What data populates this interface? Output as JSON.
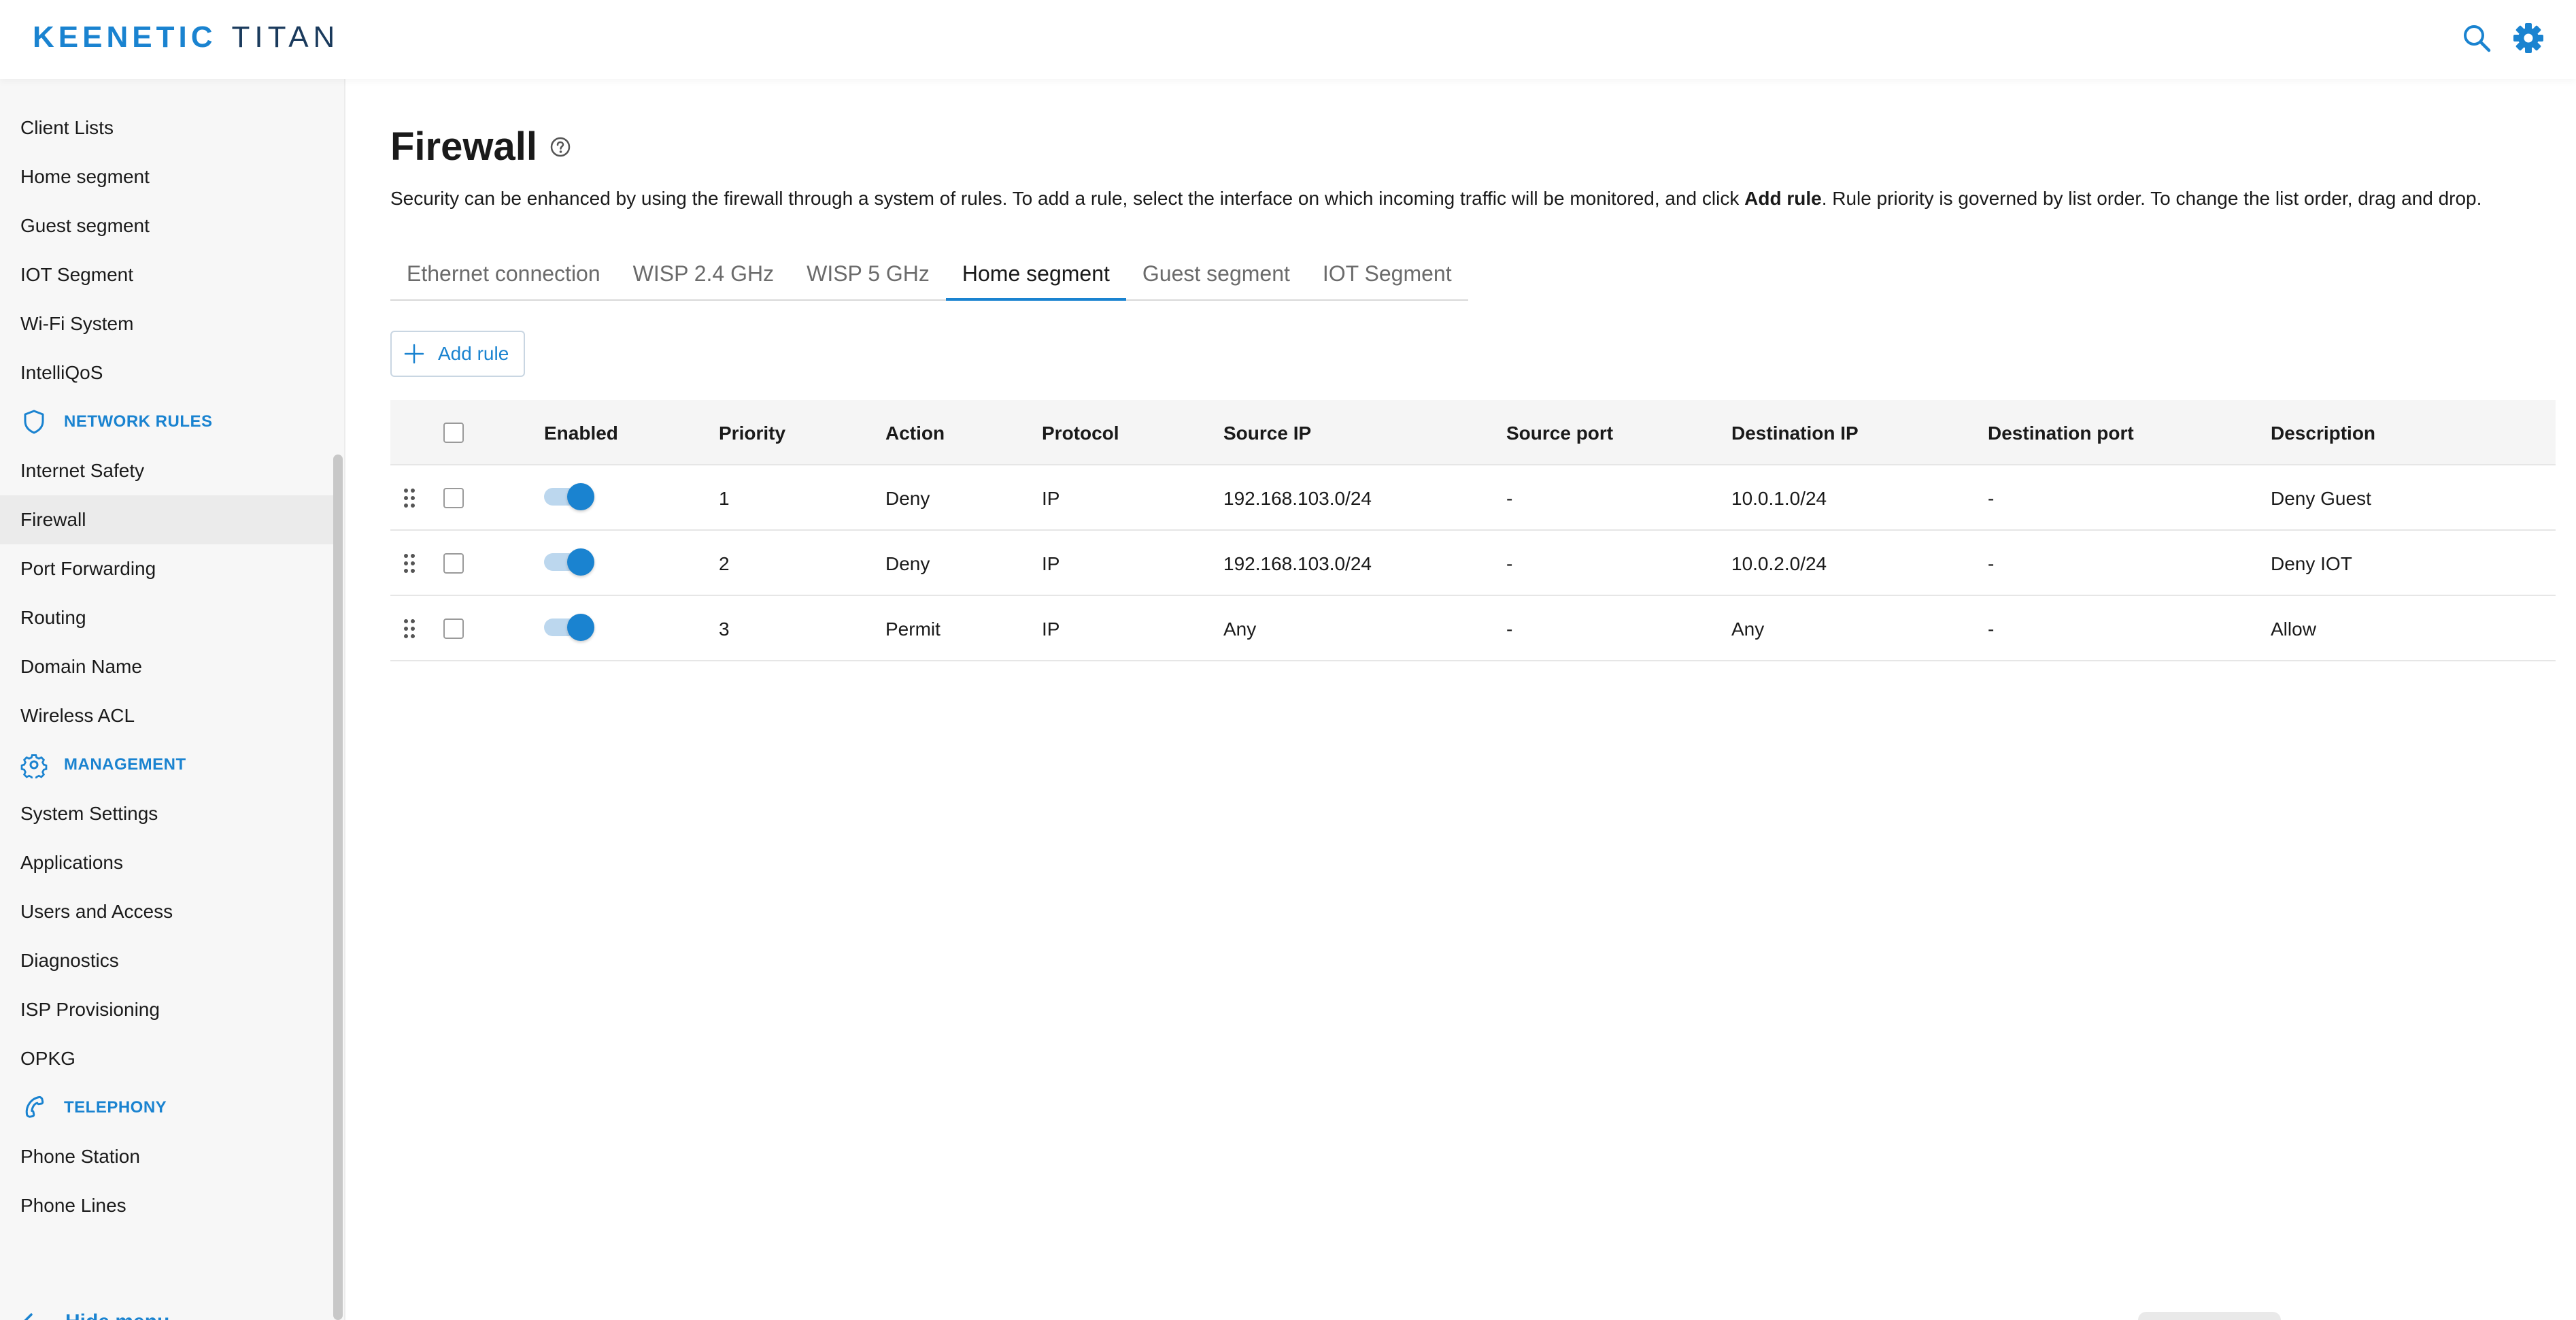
{
  "header": {
    "logo_brand": "KEENETIC",
    "logo_model": "TITAN",
    "search_icon": "search-icon",
    "settings_icon": "gear-icon"
  },
  "sidebar": {
    "items_top": [
      {
        "label": "Client Lists"
      },
      {
        "label": "Home segment"
      },
      {
        "label": "Guest segment"
      },
      {
        "label": "IOT Segment"
      },
      {
        "label": "Wi-Fi System"
      },
      {
        "label": "IntelliQoS"
      }
    ],
    "section_network_rules": {
      "label": "NETWORK RULES",
      "icon": "shield-icon"
    },
    "items_network": [
      {
        "label": "Internet Safety"
      },
      {
        "label": "Firewall",
        "active": true
      },
      {
        "label": "Port Forwarding"
      },
      {
        "label": "Routing"
      },
      {
        "label": "Domain Name"
      },
      {
        "label": "Wireless ACL"
      }
    ],
    "section_management": {
      "label": "MANAGEMENT",
      "icon": "gear-icon"
    },
    "items_management": [
      {
        "label": "System Settings"
      },
      {
        "label": "Applications"
      },
      {
        "label": "Users and Access"
      },
      {
        "label": "Diagnostics"
      },
      {
        "label": "ISP Provisioning"
      },
      {
        "label": "OPKG"
      }
    ],
    "section_telephony": {
      "label": "TELEPHONY",
      "icon": "phone-icon"
    },
    "items_telephony": [
      {
        "label": "Phone Station"
      },
      {
        "label": "Phone Lines"
      }
    ],
    "hide_menu": "Hide menu"
  },
  "main": {
    "title": "Firewall",
    "description_part1": "Security can be enhanced by using the firewall through a system of rules. To add a rule, select the interface on which incoming traffic will be monitored, and click ",
    "description_bold": "Add rule",
    "description_part2": ". Rule priority is governed by list order. To change the list order, drag and drop.",
    "tabs": [
      {
        "label": "Ethernet connection"
      },
      {
        "label": "WISP 2.4 GHz"
      },
      {
        "label": "WISP 5 GHz"
      },
      {
        "label": "Home segment",
        "active": true
      },
      {
        "label": "Guest segment"
      },
      {
        "label": "IOT Segment"
      }
    ],
    "add_rule_label": "Add rule",
    "table": {
      "headers": {
        "enabled": "Enabled",
        "priority": "Priority",
        "action": "Action",
        "protocol": "Protocol",
        "source_ip": "Source IP",
        "source_port": "Source port",
        "destination_ip": "Destination IP",
        "destination_port": "Destination port",
        "description": "Description"
      },
      "rows": [
        {
          "enabled": true,
          "priority": "1",
          "action": "Deny",
          "protocol": "IP",
          "source_ip": "192.168.103.0/24",
          "source_port": "-",
          "destination_ip": "10.0.1.0/24",
          "destination_port": "-",
          "description": "Deny Guest"
        },
        {
          "enabled": true,
          "priority": "2",
          "action": "Deny",
          "protocol": "IP",
          "source_ip": "192.168.103.0/24",
          "source_port": "-",
          "destination_ip": "10.0.2.0/24",
          "destination_port": "-",
          "description": "Deny IOT"
        },
        {
          "enabled": true,
          "priority": "3",
          "action": "Permit",
          "protocol": "IP",
          "source_ip": "Any",
          "source_port": "-",
          "destination_ip": "Any",
          "destination_port": "-",
          "description": "Allow"
        }
      ]
    }
  },
  "colors": {
    "accent": "#1a83d0",
    "sidebar_bg": "#f7f7f7",
    "toggle_track": "#bcd7ee"
  }
}
